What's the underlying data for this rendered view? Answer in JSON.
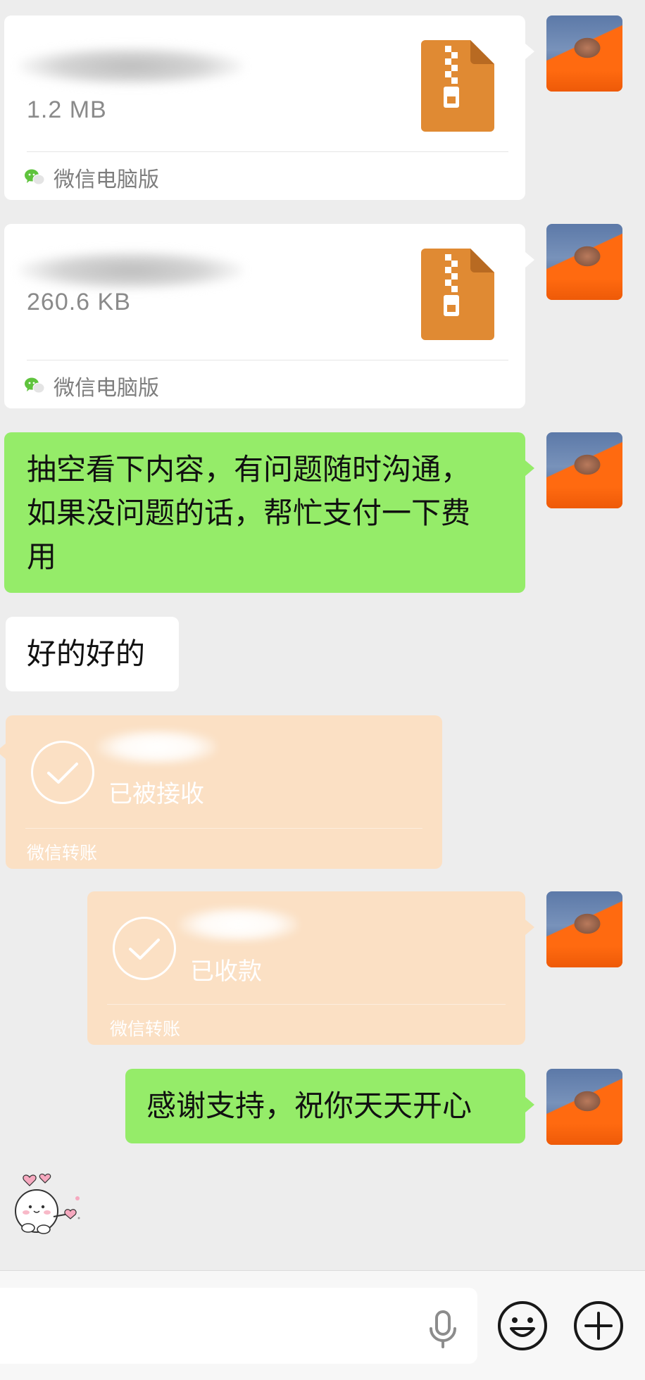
{
  "messages": {
    "file1": {
      "size": "1.2 MB",
      "source": "微信电脑版",
      "icon": "zip-file-icon"
    },
    "file2": {
      "size": "260.6 KB",
      "source": "微信电脑版",
      "icon": "zip-file-icon"
    },
    "text1": {
      "lines": [
        "抽空看下内容，有问题随时沟通，",
        "如果没问题的话，帮忙支付一下费",
        "用"
      ]
    },
    "text2": {
      "text": "好的好的"
    },
    "transfer1": {
      "status": "已被接收",
      "label": "微信转账"
    },
    "transfer2": {
      "status": "已收款",
      "label": "微信转账"
    },
    "text3": {
      "text": "感谢支持，祝你天天开心"
    }
  },
  "input_bar": {
    "icons": [
      "microphone-icon",
      "emoji-icon",
      "plus-icon"
    ]
  },
  "colors": {
    "background": "#ededed",
    "sent_bubble": "#95ec69",
    "received_bubble": "#ffffff",
    "transfer_card": "#fbe0c4",
    "zip_orange": "#e08a33"
  }
}
